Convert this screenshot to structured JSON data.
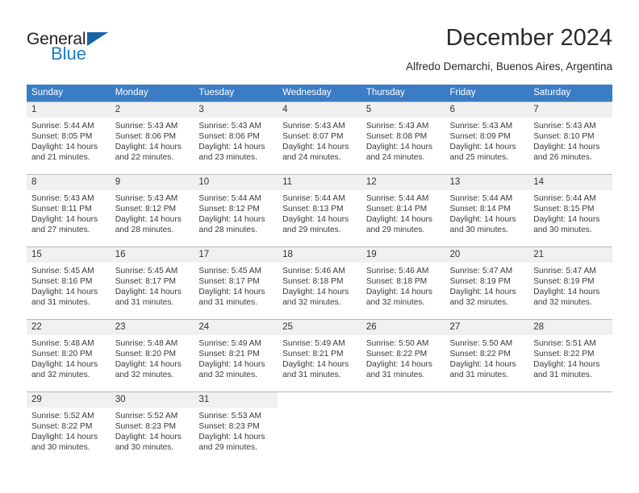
{
  "brand": {
    "name_top": "General",
    "name_bottom": "Blue",
    "triangle_color": "#1565a8",
    "blue_color": "#1d7dc4"
  },
  "header": {
    "title": "December 2024",
    "subtitle": "Alfredo Demarchi, Buenos Aires, Argentina"
  },
  "theme": {
    "header_bg": "#3b7dc4",
    "header_text": "#ffffff",
    "daynum_bg": "#f0f0f0",
    "cell_border": "#b9b9b9",
    "body_text": "#3a3a3a"
  },
  "weekday_headers": [
    "Sunday",
    "Monday",
    "Tuesday",
    "Wednesday",
    "Thursday",
    "Friday",
    "Saturday"
  ],
  "weeks": [
    [
      {
        "day": "1",
        "sunrise": "Sunrise: 5:44 AM",
        "sunset": "Sunset: 8:05 PM",
        "daylight": "Daylight: 14 hours and 21 minutes."
      },
      {
        "day": "2",
        "sunrise": "Sunrise: 5:43 AM",
        "sunset": "Sunset: 8:06 PM",
        "daylight": "Daylight: 14 hours and 22 minutes."
      },
      {
        "day": "3",
        "sunrise": "Sunrise: 5:43 AM",
        "sunset": "Sunset: 8:06 PM",
        "daylight": "Daylight: 14 hours and 23 minutes."
      },
      {
        "day": "4",
        "sunrise": "Sunrise: 5:43 AM",
        "sunset": "Sunset: 8:07 PM",
        "daylight": "Daylight: 14 hours and 24 minutes."
      },
      {
        "day": "5",
        "sunrise": "Sunrise: 5:43 AM",
        "sunset": "Sunset: 8:08 PM",
        "daylight": "Daylight: 14 hours and 24 minutes."
      },
      {
        "day": "6",
        "sunrise": "Sunrise: 5:43 AM",
        "sunset": "Sunset: 8:09 PM",
        "daylight": "Daylight: 14 hours and 25 minutes."
      },
      {
        "day": "7",
        "sunrise": "Sunrise: 5:43 AM",
        "sunset": "Sunset: 8:10 PM",
        "daylight": "Daylight: 14 hours and 26 minutes."
      }
    ],
    [
      {
        "day": "8",
        "sunrise": "Sunrise: 5:43 AM",
        "sunset": "Sunset: 8:11 PM",
        "daylight": "Daylight: 14 hours and 27 minutes."
      },
      {
        "day": "9",
        "sunrise": "Sunrise: 5:43 AM",
        "sunset": "Sunset: 8:12 PM",
        "daylight": "Daylight: 14 hours and 28 minutes."
      },
      {
        "day": "10",
        "sunrise": "Sunrise: 5:44 AM",
        "sunset": "Sunset: 8:12 PM",
        "daylight": "Daylight: 14 hours and 28 minutes."
      },
      {
        "day": "11",
        "sunrise": "Sunrise: 5:44 AM",
        "sunset": "Sunset: 8:13 PM",
        "daylight": "Daylight: 14 hours and 29 minutes."
      },
      {
        "day": "12",
        "sunrise": "Sunrise: 5:44 AM",
        "sunset": "Sunset: 8:14 PM",
        "daylight": "Daylight: 14 hours and 29 minutes."
      },
      {
        "day": "13",
        "sunrise": "Sunrise: 5:44 AM",
        "sunset": "Sunset: 8:14 PM",
        "daylight": "Daylight: 14 hours and 30 minutes."
      },
      {
        "day": "14",
        "sunrise": "Sunrise: 5:44 AM",
        "sunset": "Sunset: 8:15 PM",
        "daylight": "Daylight: 14 hours and 30 minutes."
      }
    ],
    [
      {
        "day": "15",
        "sunrise": "Sunrise: 5:45 AM",
        "sunset": "Sunset: 8:16 PM",
        "daylight": "Daylight: 14 hours and 31 minutes."
      },
      {
        "day": "16",
        "sunrise": "Sunrise: 5:45 AM",
        "sunset": "Sunset: 8:17 PM",
        "daylight": "Daylight: 14 hours and 31 minutes."
      },
      {
        "day": "17",
        "sunrise": "Sunrise: 5:45 AM",
        "sunset": "Sunset: 8:17 PM",
        "daylight": "Daylight: 14 hours and 31 minutes."
      },
      {
        "day": "18",
        "sunrise": "Sunrise: 5:46 AM",
        "sunset": "Sunset: 8:18 PM",
        "daylight": "Daylight: 14 hours and 32 minutes."
      },
      {
        "day": "19",
        "sunrise": "Sunrise: 5:46 AM",
        "sunset": "Sunset: 8:18 PM",
        "daylight": "Daylight: 14 hours and 32 minutes."
      },
      {
        "day": "20",
        "sunrise": "Sunrise: 5:47 AM",
        "sunset": "Sunset: 8:19 PM",
        "daylight": "Daylight: 14 hours and 32 minutes."
      },
      {
        "day": "21",
        "sunrise": "Sunrise: 5:47 AM",
        "sunset": "Sunset: 8:19 PM",
        "daylight": "Daylight: 14 hours and 32 minutes."
      }
    ],
    [
      {
        "day": "22",
        "sunrise": "Sunrise: 5:48 AM",
        "sunset": "Sunset: 8:20 PM",
        "daylight": "Daylight: 14 hours and 32 minutes."
      },
      {
        "day": "23",
        "sunrise": "Sunrise: 5:48 AM",
        "sunset": "Sunset: 8:20 PM",
        "daylight": "Daylight: 14 hours and 32 minutes."
      },
      {
        "day": "24",
        "sunrise": "Sunrise: 5:49 AM",
        "sunset": "Sunset: 8:21 PM",
        "daylight": "Daylight: 14 hours and 32 minutes."
      },
      {
        "day": "25",
        "sunrise": "Sunrise: 5:49 AM",
        "sunset": "Sunset: 8:21 PM",
        "daylight": "Daylight: 14 hours and 31 minutes."
      },
      {
        "day": "26",
        "sunrise": "Sunrise: 5:50 AM",
        "sunset": "Sunset: 8:22 PM",
        "daylight": "Daylight: 14 hours and 31 minutes."
      },
      {
        "day": "27",
        "sunrise": "Sunrise: 5:50 AM",
        "sunset": "Sunset: 8:22 PM",
        "daylight": "Daylight: 14 hours and 31 minutes."
      },
      {
        "day": "28",
        "sunrise": "Sunrise: 5:51 AM",
        "sunset": "Sunset: 8:22 PM",
        "daylight": "Daylight: 14 hours and 31 minutes."
      }
    ],
    [
      {
        "day": "29",
        "sunrise": "Sunrise: 5:52 AM",
        "sunset": "Sunset: 8:22 PM",
        "daylight": "Daylight: 14 hours and 30 minutes."
      },
      {
        "day": "30",
        "sunrise": "Sunrise: 5:52 AM",
        "sunset": "Sunset: 8:23 PM",
        "daylight": "Daylight: 14 hours and 30 minutes."
      },
      {
        "day": "31",
        "sunrise": "Sunrise: 5:53 AM",
        "sunset": "Sunset: 8:23 PM",
        "daylight": "Daylight: 14 hours and 29 minutes."
      },
      {
        "day": "",
        "sunrise": "",
        "sunset": "",
        "daylight": ""
      },
      {
        "day": "",
        "sunrise": "",
        "sunset": "",
        "daylight": ""
      },
      {
        "day": "",
        "sunrise": "",
        "sunset": "",
        "daylight": ""
      },
      {
        "day": "",
        "sunrise": "",
        "sunset": "",
        "daylight": ""
      }
    ]
  ]
}
